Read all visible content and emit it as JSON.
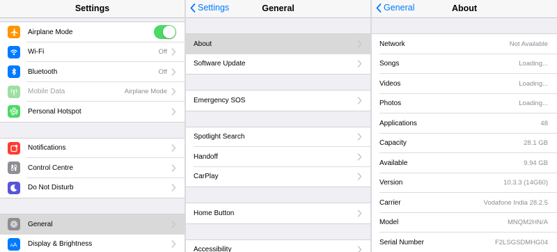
{
  "settings_pane": {
    "title": "Settings",
    "groups": [
      [
        {
          "label": "Airplane Mode",
          "icon": "airplane-icon",
          "color": "#ff9500",
          "toggle": true
        },
        {
          "label": "Wi-Fi",
          "icon": "wifi-icon",
          "color": "#007aff",
          "value": "Off"
        },
        {
          "label": "Bluetooth",
          "icon": "bluetooth-icon",
          "color": "#007aff",
          "value": "Off"
        },
        {
          "label": "Mobile Data",
          "icon": "antenna-icon",
          "color": "#9fdfa3",
          "value": "Airplane Mode",
          "disabled": true
        },
        {
          "label": "Personal Hotspot",
          "icon": "hotspot-icon",
          "color": "#4cd964"
        }
      ],
      [
        {
          "label": "Notifications",
          "icon": "notifications-icon",
          "color": "#ff3b30"
        },
        {
          "label": "Control Centre",
          "icon": "control-centre-icon",
          "color": "#8e8e93"
        },
        {
          "label": "Do Not Disturb",
          "icon": "moon-icon",
          "color": "#5856d6"
        }
      ],
      [
        {
          "label": "General",
          "icon": "gear-icon",
          "color": "#8e8e93",
          "selected": true
        },
        {
          "label": "Display & Brightness",
          "icon": "aa-icon",
          "color": "#007aff"
        }
      ]
    ]
  },
  "general_pane": {
    "back_label": "Settings",
    "title": "General",
    "groups": [
      [
        {
          "label": "About",
          "selected": true
        },
        {
          "label": "Software Update"
        }
      ],
      [
        {
          "label": "Emergency SOS"
        }
      ],
      [
        {
          "label": "Spotlight Search"
        },
        {
          "label": "Handoff"
        },
        {
          "label": "CarPlay"
        }
      ],
      [
        {
          "label": "Home Button"
        }
      ],
      [
        {
          "label": "Accessibility"
        }
      ]
    ]
  },
  "about_pane": {
    "back_label": "General",
    "title": "About",
    "rows": [
      {
        "label": "Network",
        "value": "Not Available"
      },
      {
        "label": "Songs",
        "value": "Loading..."
      },
      {
        "label": "Videos",
        "value": "Loading..."
      },
      {
        "label": "Photos",
        "value": "Loading..."
      },
      {
        "label": "Applications",
        "value": "48"
      },
      {
        "label": "Capacity",
        "value": "28.1 GB"
      },
      {
        "label": "Available",
        "value": "9.94 GB"
      },
      {
        "label": "Version",
        "value": "10.3.3 (14G60)"
      },
      {
        "label": "Carrier",
        "value": "Vodafone India 28.2.5"
      },
      {
        "label": "Model",
        "value": "MNQM2HN/A"
      },
      {
        "label": "Serial Number",
        "value": "F2LSGSDMHG04"
      }
    ]
  },
  "colors": {
    "accent": "#007aff",
    "toggle_on": "#4cd964",
    "background": "#efeff4"
  }
}
